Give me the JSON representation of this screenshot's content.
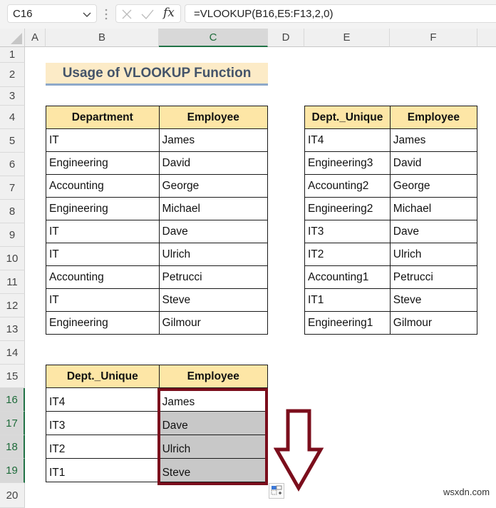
{
  "formula_bar": {
    "name_box": "C16",
    "formula": "=VLOOKUP(B16,E5:F13,2,0)",
    "fx_label": "fx"
  },
  "columns": [
    "A",
    "B",
    "C",
    "D",
    "E",
    "F"
  ],
  "selected_column": "C",
  "rows": [
    "1",
    "2",
    "3",
    "4",
    "5",
    "6",
    "7",
    "8",
    "9",
    "10",
    "11",
    "12",
    "13",
    "14",
    "15",
    "16",
    "17",
    "18",
    "19",
    "20"
  ],
  "selected_rows": [
    "16",
    "17",
    "18",
    "19"
  ],
  "title": "Usage of VLOOKUP Function",
  "table_main": {
    "headers": [
      "Department",
      "Employee"
    ],
    "rows": [
      [
        "IT",
        "James"
      ],
      [
        "Engineering",
        "David"
      ],
      [
        "Accounting",
        "George"
      ],
      [
        "Engineering",
        "Michael"
      ],
      [
        "IT",
        "Dave"
      ],
      [
        "IT",
        "Ulrich"
      ],
      [
        "Accounting",
        "Petrucci"
      ],
      [
        "IT",
        "Steve"
      ],
      [
        "Engineering",
        "Gilmour"
      ]
    ]
  },
  "table_unique": {
    "headers": [
      "Dept._Unique",
      "Employee"
    ],
    "rows": [
      [
        "IT4",
        "James"
      ],
      [
        "Engineering3",
        "David"
      ],
      [
        "Accounting2",
        "George"
      ],
      [
        "Engineering2",
        "Michael"
      ],
      [
        "IT3",
        "Dave"
      ],
      [
        "IT2",
        "Ulrich"
      ],
      [
        "Accounting1",
        "Petrucci"
      ],
      [
        "IT1",
        "Steve"
      ],
      [
        "Engineering1",
        "Gilmour"
      ]
    ]
  },
  "table_result": {
    "headers": [
      "Dept._Unique",
      "Employee"
    ],
    "rows": [
      [
        "IT4",
        "James"
      ],
      [
        "IT3",
        "Dave"
      ],
      [
        "IT2",
        "Ulrich"
      ],
      [
        "IT1",
        "Steve"
      ]
    ]
  },
  "watermark": "wsxdn.com",
  "colors": {
    "header_fill": "#fde6a6",
    "title_fill": "#fcebc7",
    "selection_border": "#7b0e1c",
    "excel_green": "#217346"
  }
}
